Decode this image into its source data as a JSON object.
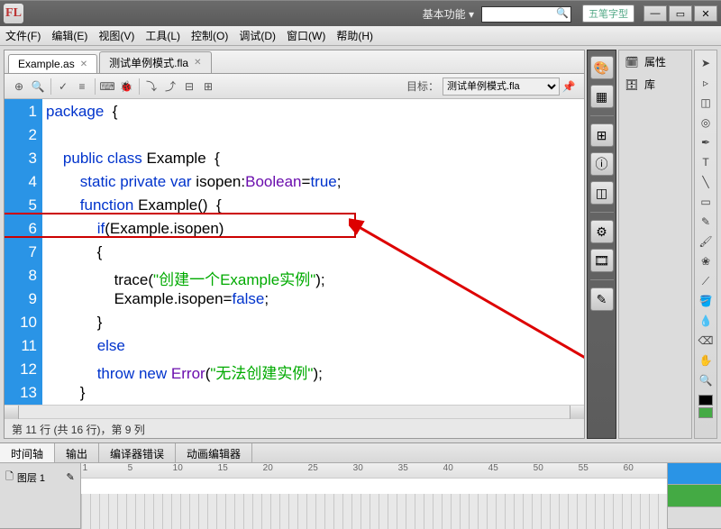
{
  "titlebar": {
    "logo": "FL",
    "workspace_label": "基本功能 ▾",
    "search_placeholder": "",
    "ime_label": "五笔字型"
  },
  "menus": [
    "文件(F)",
    "编辑(E)",
    "视图(V)",
    "工具(L)",
    "控制(O)",
    "调试(D)",
    "窗口(W)",
    "帮助(H)"
  ],
  "tabs": [
    {
      "label": "Example.as",
      "active": true
    },
    {
      "label": "测试单例模式.fla",
      "active": false
    }
  ],
  "toolbar": {
    "target_label": "目标：",
    "target_value": "测试单例模式.fla"
  },
  "code": {
    "lines": [
      [
        [
          "kw",
          "package"
        ],
        [
          "",
          "  {"
        ]
      ],
      [
        [
          "",
          ""
        ]
      ],
      [
        [
          "",
          "    "
        ],
        [
          "kw",
          "public class"
        ],
        [
          "",
          " Example  {"
        ]
      ],
      [
        [
          "",
          "        "
        ],
        [
          "kw",
          "static private var"
        ],
        [
          "",
          " isopen:"
        ],
        [
          "cls",
          "Boolean"
        ],
        [
          "",
          "="
        ],
        [
          "kw",
          "true"
        ],
        [
          "",
          ";"
        ]
      ],
      [
        [
          "",
          "        "
        ],
        [
          "kw",
          "function"
        ],
        [
          "",
          " Example()  {"
        ]
      ],
      [
        [
          "",
          "            "
        ],
        [
          "kw",
          "if"
        ],
        [
          "",
          "(Example.isopen)"
        ]
      ],
      [
        [
          "",
          "            {"
        ]
      ],
      [
        [
          "",
          "                trace("
        ],
        [
          "str",
          "\"创建一个Example实例\""
        ],
        [
          "",
          ");"
        ]
      ],
      [
        [
          "",
          "                Example.isopen="
        ],
        [
          "kw",
          "false"
        ],
        [
          "",
          ";"
        ]
      ],
      [
        [
          "",
          "            }"
        ]
      ],
      [
        [
          "",
          "            "
        ],
        [
          "kw",
          "else"
        ]
      ],
      [
        [
          "",
          "            "
        ],
        [
          "kw",
          "throw new"
        ],
        [
          "",
          " "
        ],
        [
          "cls",
          "Error"
        ],
        [
          "",
          "("
        ],
        [
          "str",
          "\"无法创建实例\""
        ],
        [
          "",
          ");"
        ]
      ],
      [
        [
          "",
          "        }"
        ]
      ],
      [
        [
          "",
          "    }"
        ]
      ],
      [
        [
          "",
          ""
        ]
      ],
      [
        [
          "",
          ""
        ]
      ]
    ]
  },
  "status": "第 11 行 (共 16 行)，第 9 列",
  "panel2": {
    "properties": "属性",
    "library": "库"
  },
  "bottom_tabs": [
    "时间轴",
    "输出",
    "编译器错误",
    "动画编辑器"
  ],
  "layer": {
    "name": "图层 1"
  },
  "frames": [
    "1",
    "5",
    "10",
    "15",
    "20",
    "25",
    "30",
    "35",
    "40",
    "45",
    "50",
    "55",
    "60"
  ]
}
